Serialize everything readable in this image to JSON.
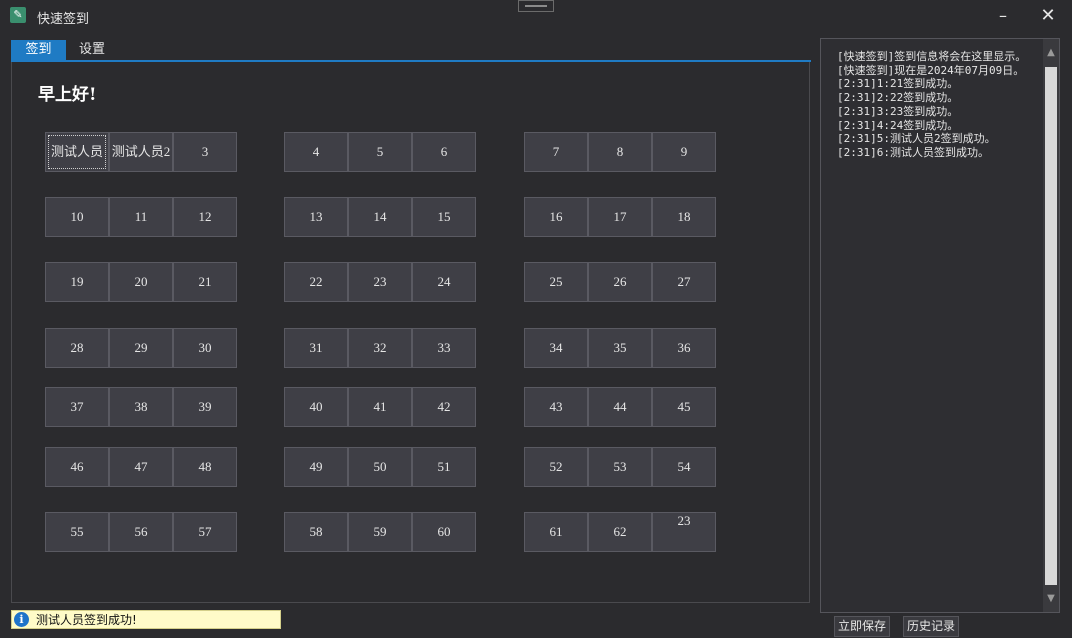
{
  "window": {
    "title": "快速签到",
    "app_icon_glyph": "✎",
    "minimize_icon": "minimize-icon",
    "close_icon": "close-icon"
  },
  "tabs": [
    {
      "label": "签到",
      "active": true
    },
    {
      "label": "设置",
      "active": false
    }
  ],
  "greeting": "早上好!",
  "seats": [
    [
      "测试人员",
      "测试人员2",
      "3",
      "4",
      "5",
      "6",
      "7",
      "8",
      "9"
    ],
    [
      "10",
      "11",
      "12",
      "13",
      "14",
      "15",
      "16",
      "17",
      "18"
    ],
    [
      "19",
      "20",
      "21",
      "22",
      "23",
      "24",
      "25",
      "26",
      "27"
    ],
    [
      "28",
      "29",
      "30",
      "31",
      "32",
      "33",
      "34",
      "35",
      "36"
    ],
    [
      "37",
      "38",
      "39",
      "40",
      "41",
      "42",
      "43",
      "44",
      "45"
    ],
    [
      "46",
      "47",
      "48",
      "49",
      "50",
      "51",
      "52",
      "53",
      "54"
    ],
    [
      "55",
      "56",
      "57",
      "58",
      "59",
      "60",
      "61",
      "62",
      "23"
    ]
  ],
  "log": [
    "[快速签到]签到信息将会在这里显示。",
    "[快速签到]现在是2024年07月09日。",
    "[2:31]1:21签到成功。",
    "[2:31]2:22签到成功。",
    "[2:31]3:23签到成功。",
    "[2:31]4:24签到成功。",
    "[2:31]5:测试人员2签到成功。",
    "[2:31]6:测试人员签到成功。"
  ],
  "status": {
    "icon": "info-icon",
    "text": "测试人员签到成功!"
  },
  "buttons": {
    "save": "立即保存",
    "history": "历史记录"
  },
  "colors": {
    "accent": "#1f7bc4",
    "background": "#2b2b2e",
    "seat": "#3f3f46",
    "status_bg": "#fffbc8"
  }
}
